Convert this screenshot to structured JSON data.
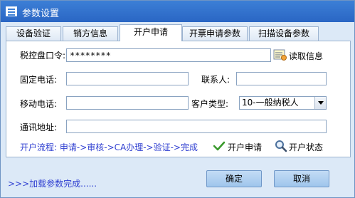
{
  "window": {
    "title": "参数设置"
  },
  "tabs": [
    {
      "label": "设备验证"
    },
    {
      "label": "销方信息"
    },
    {
      "label": "开户申请"
    },
    {
      "label": "开票申请参数"
    },
    {
      "label": "扫描设备参数"
    }
  ],
  "form": {
    "tax_password_label": "税控盘口令:",
    "tax_password_value": "********",
    "read_info_label": "读取信息",
    "landline_label": "固定电话:",
    "landline_value": "",
    "contact_label": "联系人:",
    "contact_value": "",
    "mobile_label": "移动电话:",
    "mobile_value": "",
    "customer_type_label": "客户类型:",
    "customer_type_value": "10-一般纳税人",
    "address_label": "通讯地址:",
    "address_value": "",
    "flow_text": "开户流程: 申请->审核->CA办理->验证->完成",
    "apply_label": "开户申请",
    "status_label": "开户状态"
  },
  "footer": {
    "status_text": ">>>加载参数完成......",
    "ok_label": "确定",
    "cancel_label": "取消"
  },
  "colors": {
    "titlebar": "#3c7fd6",
    "link_text": "#2f3fd1",
    "button": "#a9cdef"
  }
}
